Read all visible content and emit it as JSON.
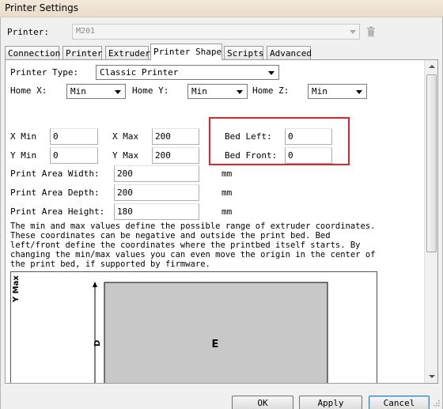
{
  "window": {
    "title": "Printer Settings"
  },
  "printer": {
    "label": "Printer:",
    "value": "M201"
  },
  "tabs": [
    {
      "label": "Connection"
    },
    {
      "label": "Printer"
    },
    {
      "label": "Extruder"
    },
    {
      "label": "Printer Shape",
      "active": true
    },
    {
      "label": "Scripts"
    },
    {
      "label": "Advanced"
    }
  ],
  "shape": {
    "printer_type_label": "Printer Type:",
    "printer_type_value": "Classic Printer",
    "home_x_label": "Home X:",
    "home_x_value": "Min",
    "home_y_label": "Home Y:",
    "home_y_value": "Min",
    "home_z_label": "Home Z:",
    "home_z_value": "Min",
    "x_min_label": "X Min",
    "x_min_value": "0",
    "x_max_label": "X Max",
    "x_max_value": "200",
    "y_min_label": "Y Min",
    "y_min_value": "0",
    "y_max_label": "Y Max",
    "y_max_value": "200",
    "bed_left_label": "Bed Left:",
    "bed_left_value": "0",
    "bed_front_label": "Bed Front:",
    "bed_front_value": "0",
    "area_width_label": "Print Area Width:",
    "area_width_value": "200",
    "area_width_unit": "mm",
    "area_depth_label": "Print Area Depth:",
    "area_depth_value": "200",
    "area_depth_unit": "mm",
    "area_height_label": "Print Area Height:",
    "area_height_value": "180",
    "area_height_unit": "mm",
    "description": "The min and max values define the possible range of extruder coordinates.\nThese coordinates can be negative and outside the print bed. Bed\nleft/front define the coordinates where the printbed itself starts. By\nchanging the min/max values you can even move the origin in the center of\nthe print bed, if supported by firmware."
  },
  "diagram": {
    "y_axis_label": "Y Max",
    "d_label": "D",
    "e_label": "E",
    "bed_color": "#c8c8c8"
  },
  "buttons": {
    "ok": "OK",
    "apply": "Apply",
    "cancel": "Cancel"
  },
  "colors": {
    "highlight": "#e0242c",
    "titlebar": "#efe3d4"
  }
}
